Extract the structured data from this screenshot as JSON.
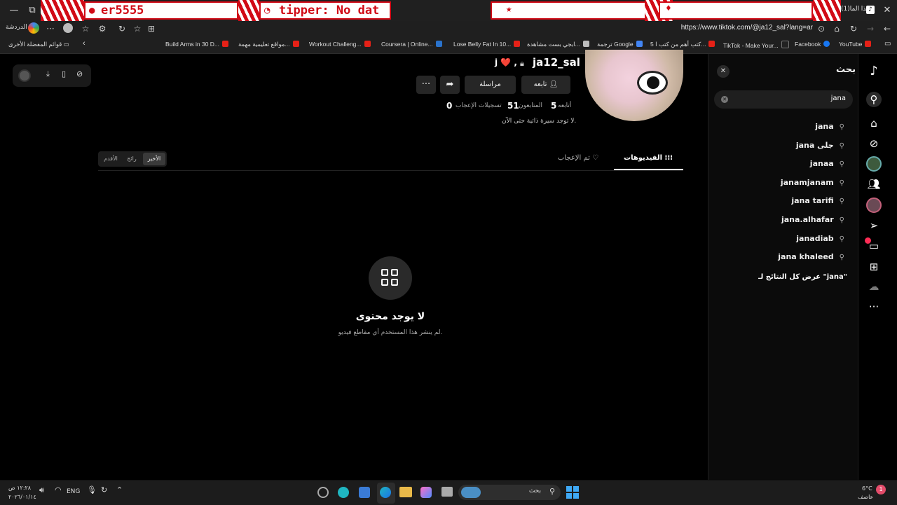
{
  "browser": {
    "tab_banner_1": "er5555",
    "tab_banner_2": "tipper: No dat",
    "tab_title": "هذا الما(1)",
    "url": "https://www.tiktok.com/@ja12_sal?lang=ar",
    "chat_label": "الدردشة",
    "bookmarks": [
      {
        "label": "YouTube",
        "color": "#e62117"
      },
      {
        "label": "Facebook",
        "color": "#1877f2"
      },
      {
        "label": "TikTok - Make Your...",
        "color": "#222222"
      },
      {
        "label": "5 كتب أهم من كتب ا...",
        "color": "#e62117"
      },
      {
        "label": "ترجمة Google",
        "color": "#4285f4"
      },
      {
        "label": "ابجي بست مشاهدة...",
        "color": "#bdbdbd"
      },
      {
        "label": "Lose Belly Fat In 10...",
        "color": "#e62117"
      },
      {
        "label": "Coursera | Online...",
        "color": "#2a73cc"
      },
      {
        "label": "Workout Challeng...",
        "color": "#e62117"
      },
      {
        "label": "مواقع تعليمية مهمة...",
        "color": "#e62117"
      },
      {
        "label": "Build Arms in 30 D...",
        "color": "#e62117"
      }
    ],
    "other_favorites": "قوائم المفضلة الأخرى"
  },
  "search": {
    "title": "بحث",
    "query": "jana",
    "suggestions": [
      "jana",
      "jana جلى",
      "janaa",
      "janamjanam",
      "jana tarifi",
      "jana.alhafar",
      "janadiab",
      "jana khaleed"
    ],
    "see_all": "عرض كل النتائج لـ \"jana\""
  },
  "profile": {
    "username": "ja12_sal",
    "nickname": "j ❤️ ,",
    "follow_btn": "تابعه",
    "message_btn": "مراسلة",
    "following_count": "5",
    "following_label": "أتابعه",
    "followers_count": "51",
    "followers_label": "المتابعون",
    "likes_count": "0",
    "likes_label": "تسجيلات الإعجاب",
    "bio": "لا توجد سيرة ذاتية حتى الآن.",
    "tabs": [
      "الفيديوهات",
      "تم الإعجاب"
    ],
    "sort": [
      "الأخير",
      "رائج",
      "الأقدم"
    ],
    "empty_title": "لا يوجد محتوى",
    "empty_sub": "لم ينشر هذا المستخدم أي مقاطع فيديو."
  },
  "taskbar": {
    "weather_temp": "6°C",
    "weather_desc": "عاصف",
    "search_placeholder": "بحث",
    "lang": "ENG",
    "time": "١٢:٢٨ ص",
    "date": "٢٠٢٦/٠١/١٤",
    "notif_badge": "1"
  },
  "colors": {
    "accent": "#fe2c55",
    "banner_red": "#d10a16"
  }
}
